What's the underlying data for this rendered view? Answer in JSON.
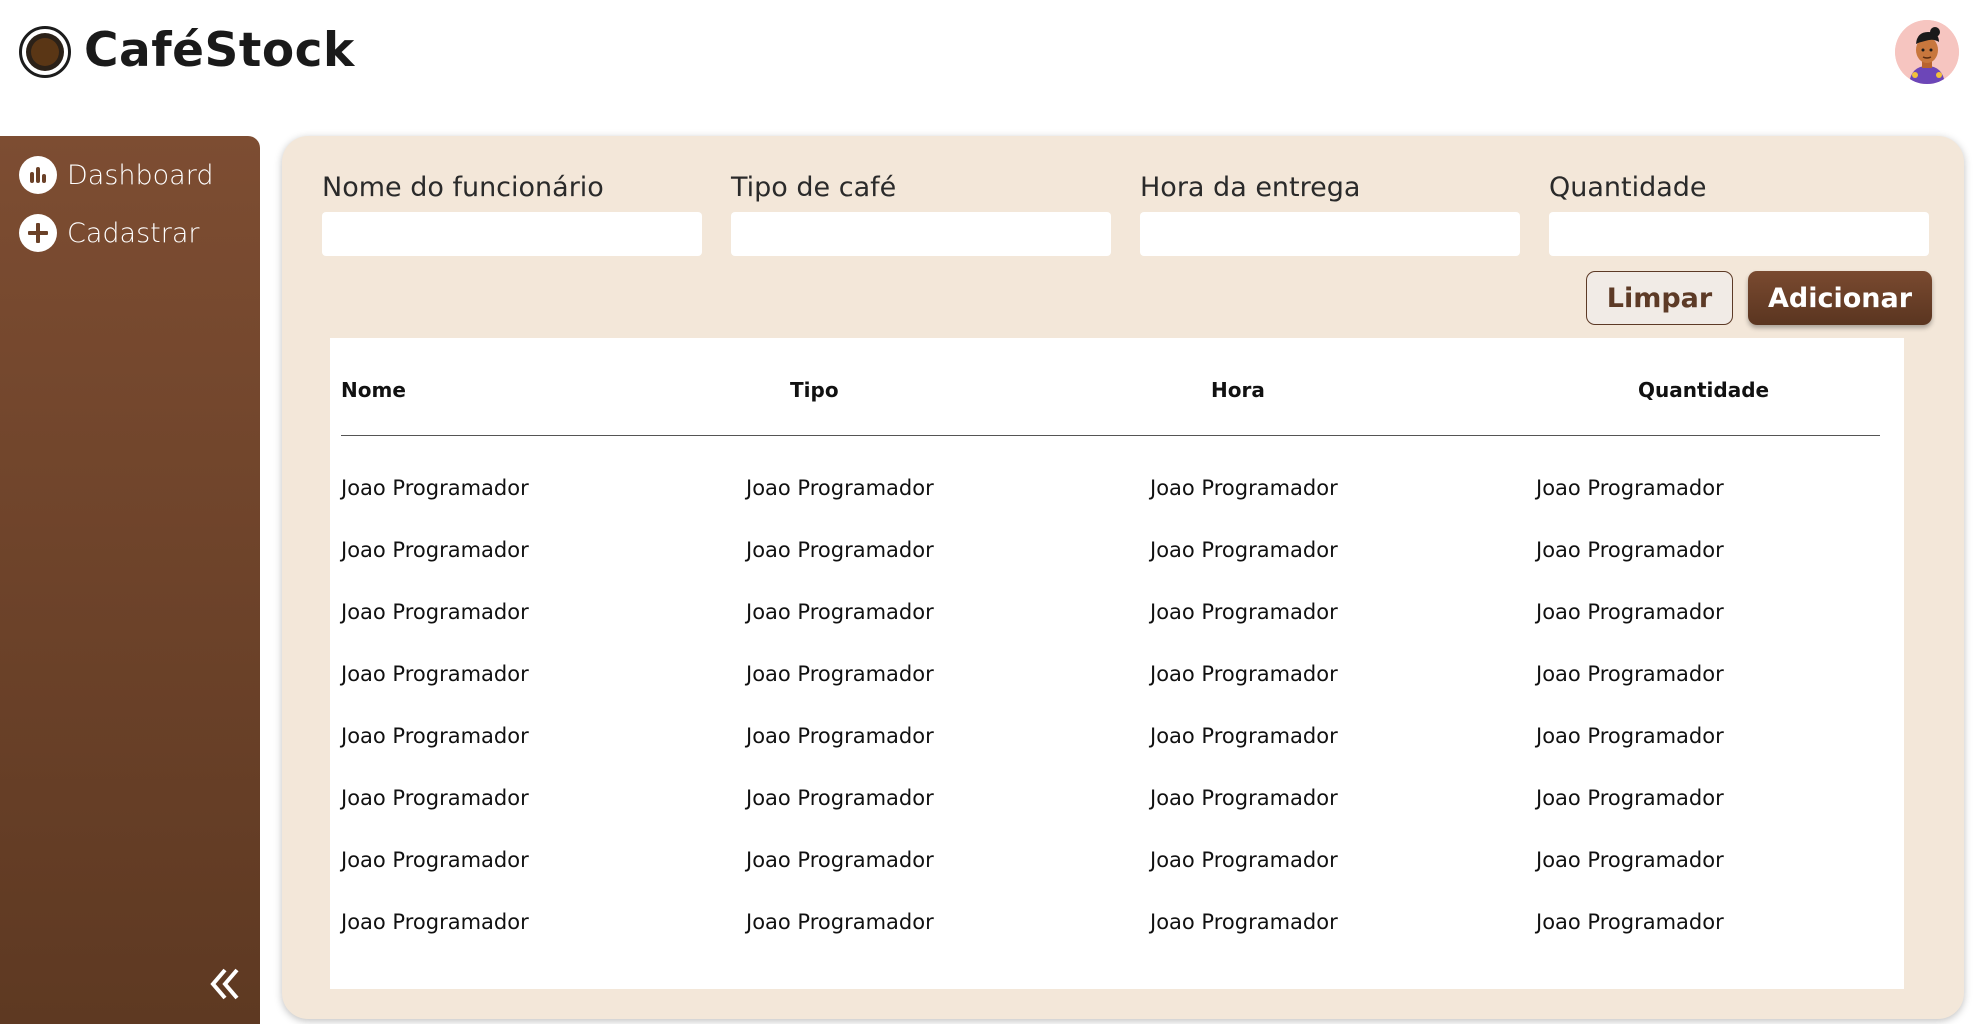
{
  "app": {
    "title": "CaféStock"
  },
  "sidebar": {
    "items": [
      {
        "label": "Dashboard",
        "icon": "bar-chart-icon"
      },
      {
        "label": "Cadastrar",
        "icon": "plus-icon"
      }
    ],
    "collapse_icon": "double-chevron-left-icon"
  },
  "form": {
    "fields": [
      {
        "label": "Nome do funcionário",
        "value": ""
      },
      {
        "label": "Tipo de café",
        "value": ""
      },
      {
        "label": "Hora da entrega",
        "value": ""
      },
      {
        "label": "Quantidade",
        "value": ""
      }
    ],
    "clear_label": "Limpar",
    "add_label": "Adicionar"
  },
  "table": {
    "headers": [
      "Nome",
      "Tipo",
      "Hora",
      "Quantidade"
    ],
    "rows": [
      [
        "Joao Programador",
        "Joao Programador",
        "Joao Programador",
        "Joao Programador"
      ],
      [
        "Joao Programador",
        "Joao Programador",
        "Joao Programador",
        "Joao Programador"
      ],
      [
        "Joao Programador",
        "Joao Programador",
        "Joao Programador",
        "Joao Programador"
      ],
      [
        "Joao Programador",
        "Joao Programador",
        "Joao Programador",
        "Joao Programador"
      ],
      [
        "Joao Programador",
        "Joao Programador",
        "Joao Programador",
        "Joao Programador"
      ],
      [
        "Joao Programador",
        "Joao Programador",
        "Joao Programador",
        "Joao Programador"
      ],
      [
        "Joao Programador",
        "Joao Programador",
        "Joao Programador",
        "Joao Programador"
      ],
      [
        "Joao Programador",
        "Joao Programador",
        "Joao Programador",
        "Joao Programador"
      ]
    ]
  },
  "colors": {
    "brand_brown": "#6b4128",
    "panel_beige": "#f3e7d9",
    "avatar_bg": "#f6c5c0"
  }
}
